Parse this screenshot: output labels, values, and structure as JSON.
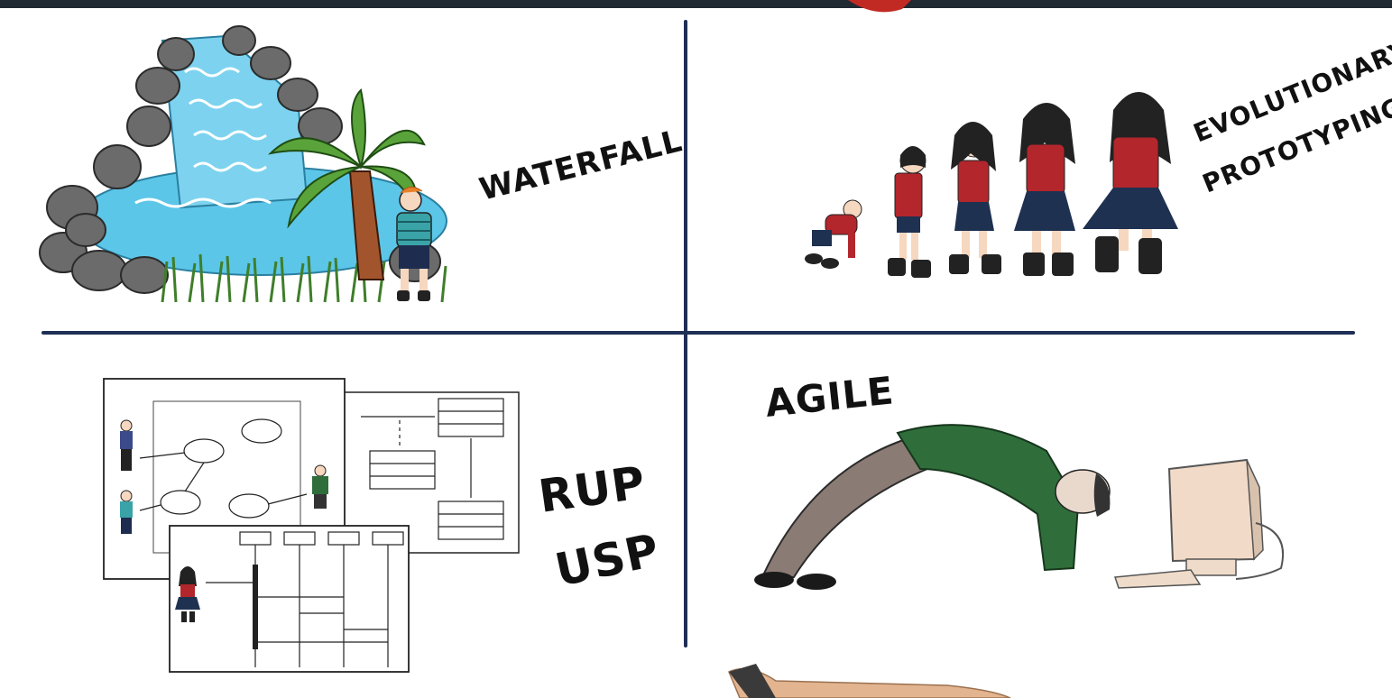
{
  "quadrants": {
    "top_left": {
      "label": "WATERFALL"
    },
    "top_right": {
      "label_line1": "EVOLUTIONARY",
      "label_line2": "PROTOTYPING"
    },
    "bottom_left": {
      "label_line1": "RUP",
      "label_line2": "USP"
    },
    "bottom_right": {
      "label": "AGILE"
    }
  },
  "colors": {
    "divider": "#1e2f55",
    "water": "#5cc6e8",
    "rock": "#6b6b6b",
    "palm_leaf": "#5aa33a",
    "palm_trunk": "#a2552c",
    "grass": "#3f7e2a",
    "shirt_red": "#b3262c",
    "skirt_navy": "#1f3151",
    "agile_shirt": "#2f6e3b",
    "agile_pants": "#8a7b74",
    "monitor": "#f1dbc8"
  },
  "icons": [
    "waterfall-illustration",
    "evolution-illustration",
    "uml-diagram-illustration",
    "agile-person-illustration"
  ]
}
